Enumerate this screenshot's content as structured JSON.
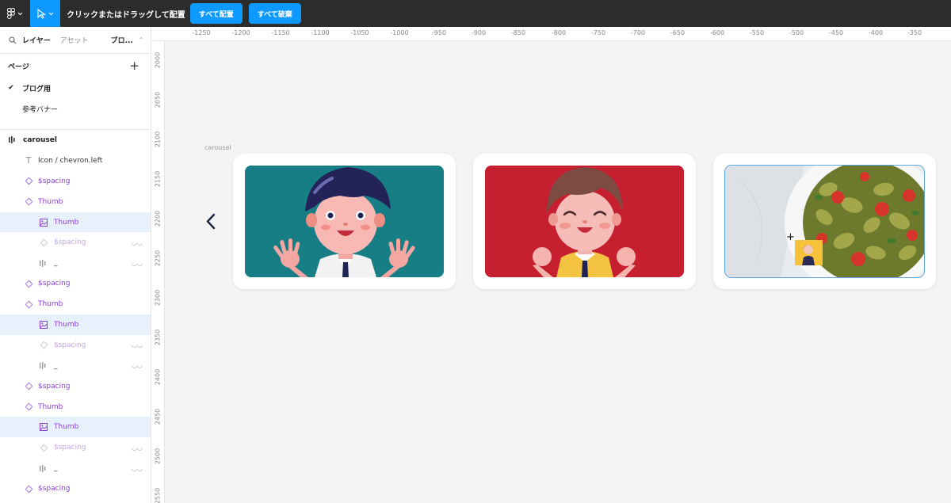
{
  "toolbar": {
    "hint": "クリックまたはドラッグして配置",
    "place_all": "すべて配置",
    "discard_all": "すべて破棄"
  },
  "sidebar": {
    "tabs": {
      "layers": "レイヤー",
      "assets": "アセット",
      "page": "ブロ..."
    },
    "pages_title": "ページ",
    "pages": [
      {
        "label": "ブログ用",
        "checked": "✔"
      },
      {
        "label": "参考バナー"
      }
    ],
    "layers": [
      {
        "label": "carousel"
      },
      {
        "label": "Icon / chevron.left"
      },
      {
        "label": "$spacing"
      },
      {
        "label": "Thumb"
      },
      {
        "label": "Thumb"
      },
      {
        "label": "$spacing"
      },
      {
        "label": "_"
      },
      {
        "label": "$spacing"
      },
      {
        "label": "Thumb"
      },
      {
        "label": "Thumb"
      },
      {
        "label": "$spacing"
      },
      {
        "label": "_"
      },
      {
        "label": "$spacing"
      },
      {
        "label": "Thumb"
      },
      {
        "label": "Thumb"
      },
      {
        "label": "$spacing"
      },
      {
        "label": "_"
      },
      {
        "label": "$spacing"
      }
    ]
  },
  "ruler": {
    "top": [
      "-1250",
      "-1200",
      "-1150",
      "-1100",
      "-1050",
      "-1000",
      "-950",
      "-900",
      "-850",
      "-800",
      "-750",
      "-700",
      "-650",
      "-600",
      "-550",
      "-500",
      "-450",
      "-400",
      "-350"
    ],
    "left": [
      "2000",
      "2050",
      "2100",
      "2150",
      "2200",
      "2250",
      "2300",
      "2350",
      "2400",
      "2450",
      "2500",
      "2550"
    ]
  },
  "canvas": {
    "frame_label": "carousel"
  },
  "colors": {
    "accent": "#0d99ff",
    "card1_bg": "#1b7f85",
    "card2_bg": "#c61f30",
    "component_purple": "#8b3fd8"
  }
}
